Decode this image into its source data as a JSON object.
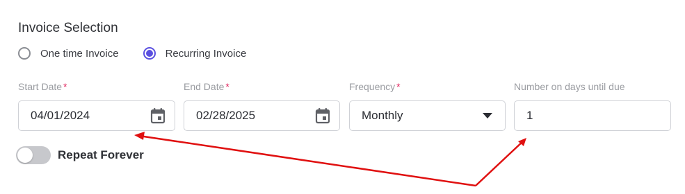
{
  "section": {
    "title": "Invoice Selection"
  },
  "invoice_type": {
    "options": [
      {
        "label": "One time Invoice",
        "selected": false
      },
      {
        "label": "Recurring Invoice",
        "selected": true
      }
    ]
  },
  "fields": {
    "start_date": {
      "label": "Start Date",
      "required_mark": "*",
      "value": "04/01/2024",
      "icon": "calendar-icon"
    },
    "end_date": {
      "label": "End Date",
      "required_mark": "*",
      "value": "02/28/2025",
      "icon": "calendar-icon"
    },
    "frequency": {
      "label": "Frequency",
      "required_mark": "*",
      "value": "Monthly",
      "icon": "caret-down-icon"
    },
    "days_until_due": {
      "label": "Number on days until due",
      "value": "1"
    }
  },
  "repeat": {
    "label": "Repeat Forever",
    "enabled": false
  },
  "colors": {
    "accent": "#5a4fe0",
    "required": "#e0245e",
    "annotation": "#e01010"
  }
}
